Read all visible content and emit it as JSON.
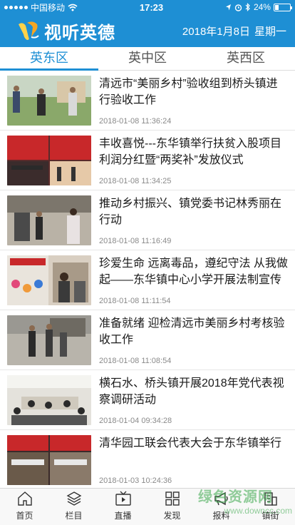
{
  "status_bar": {
    "carrier": "中国移动",
    "time": "17:23",
    "battery": "24%",
    "battery_level": 0.24
  },
  "header": {
    "app_title": "视听英德",
    "date": "2018年1月8日",
    "weekday": "星期一"
  },
  "tabs": [
    {
      "label": "英东区",
      "active": true
    },
    {
      "label": "英中区",
      "active": false
    },
    {
      "label": "英西区",
      "active": false
    }
  ],
  "news": [
    {
      "title": "清远市“美丽乡村”验收组到桥头镇进行验收工作",
      "time": "2018-01-08 11:36:24"
    },
    {
      "title": "丰收喜悦---东华镇举行扶贫入股项目利润分红暨“两奖补”发放仪式",
      "time": "2018-01-08 11:34:25"
    },
    {
      "title": "推动乡村振兴、镇党委书记林秀丽在行动",
      "time": "2018-01-08 11:16:49"
    },
    {
      "title": "珍爱生命 远离毒品，遵纪守法 从我做起——东华镇中心小学开展法制宣传进校",
      "time": "2018-01-08 11:11:54"
    },
    {
      "title": "准备就绪 迎检清远市美丽乡村考核验收工作",
      "time": "2018-01-08 11:08:54"
    },
    {
      "title": "横石水、桥头镇开展2018年党代表视察调研活动",
      "time": "2018-01-04 09:34:28"
    },
    {
      "title": "清华园工联会代表大会于东华镇举行",
      "time": "2018-01-03 10:24:36"
    }
  ],
  "tabbar": [
    {
      "label": "首页",
      "icon": "home-icon"
    },
    {
      "label": "栏目",
      "icon": "layers-icon"
    },
    {
      "label": "直播",
      "icon": "tv-icon"
    },
    {
      "label": "发现",
      "icon": "grid-icon"
    },
    {
      "label": "报料",
      "icon": "megaphone-icon"
    },
    {
      "label": "镇街",
      "icon": "building-icon"
    }
  ],
  "watermark": {
    "text": "绿色资源网",
    "url": "www.downcc.com"
  },
  "colors": {
    "brand": "#1e8fd4",
    "watermark": "#3aa84b"
  }
}
